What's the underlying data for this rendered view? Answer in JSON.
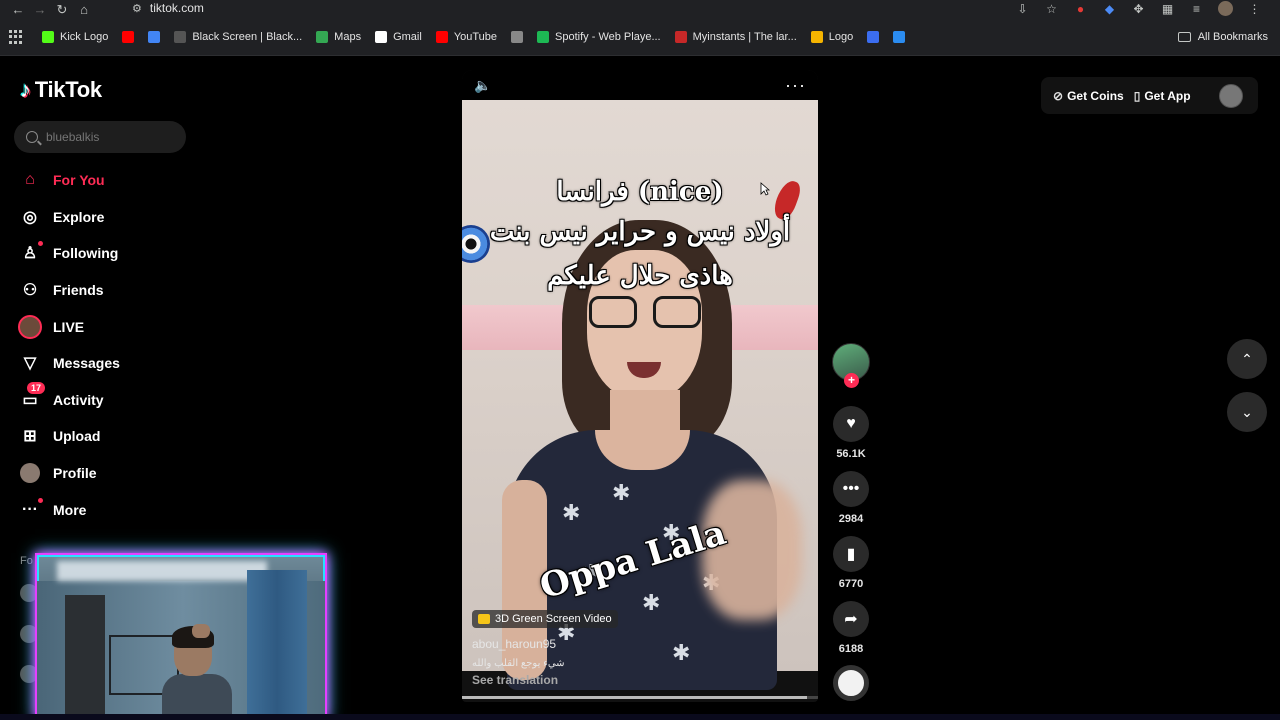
{
  "browser": {
    "url": "tiktok.com",
    "bookmarks": [
      {
        "label": "Kick Logo",
        "color": "#53fc18"
      },
      {
        "label": "",
        "color": "#ff0000"
      },
      {
        "label": "",
        "color": "#4285f4"
      },
      {
        "label": "Black Screen | Black...",
        "color": "#555555"
      },
      {
        "label": "Maps",
        "color": "#34a853"
      },
      {
        "label": "Gmail",
        "color": "#ffffff"
      },
      {
        "label": "YouTube",
        "color": "#ff0000"
      },
      {
        "label": "",
        "color": "#888888"
      },
      {
        "label": "Spotify - Web Playe...",
        "color": "#1db954"
      },
      {
        "label": "Myinstants | The lar...",
        "color": "#c62828"
      },
      {
        "label": "Logo",
        "color": "#f5b400"
      },
      {
        "label": "",
        "color": "#3b6df0"
      },
      {
        "label": "",
        "color": "#2b8cf0"
      }
    ],
    "all_bookmarks": "All Bookmarks"
  },
  "sidebar": {
    "logo": "TikTok",
    "search_placeholder": "bluebalkis",
    "items": [
      {
        "label": "For You",
        "icon": "home-icon",
        "glyph": "⌂",
        "active": true
      },
      {
        "label": "Explore",
        "icon": "compass-icon",
        "glyph": "◎"
      },
      {
        "label": "Following",
        "icon": "following-icon",
        "glyph": "♙"
      },
      {
        "label": "Friends",
        "icon": "friends-icon",
        "glyph": "⚇"
      },
      {
        "label": "LIVE",
        "icon": "live-avatar-icon",
        "glyph": ""
      },
      {
        "label": "Messages",
        "icon": "messages-icon",
        "glyph": "▽"
      },
      {
        "label": "Activity",
        "icon": "activity-icon",
        "glyph": "▭",
        "badge": "17"
      },
      {
        "label": "Upload",
        "icon": "upload-icon",
        "glyph": "⊞"
      },
      {
        "label": "Profile",
        "icon": "profile-avatar-icon",
        "glyph": ""
      },
      {
        "label": "More",
        "icon": "more-icon",
        "glyph": "···"
      }
    ],
    "following_label": "Fo"
  },
  "video": {
    "caption_line1": "فرانسا (nice)",
    "caption_line2": "أولاد نيس و حراير نيس بنت",
    "caption_line3": "هاذى حلال عليكم",
    "overlay_text": "Oppa Lala",
    "effect": "3D Green Screen Video",
    "author": "abou_haroun95",
    "description": "شيء يوجع القلب والله",
    "see_translation": "See translation",
    "progress": 0.97
  },
  "actions": {
    "likes": "56.1K",
    "comments": "2984",
    "saves": "6770",
    "shares": "6188"
  },
  "topbar": {
    "get_coins": "Get Coins",
    "get_app": "Get App"
  },
  "colors": {
    "accent": "#fe2c55",
    "background": "#000000",
    "chrome": "#202124"
  }
}
